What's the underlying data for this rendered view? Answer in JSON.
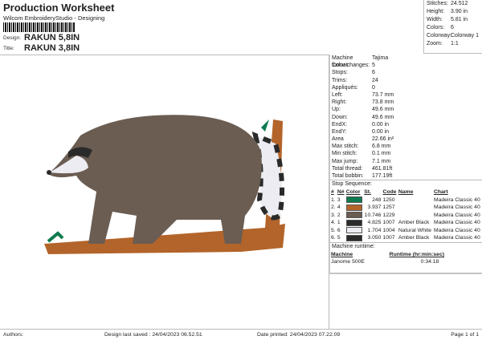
{
  "header": {
    "title": "Production Worksheet",
    "subtitle": "Wilcom EmbroideryStudio - Designing",
    "design_label": "Design:",
    "design": "RAKUN 5,8IN",
    "title_label": "Title:",
    "title_value": "RAKUN 3,8IN"
  },
  "stats": [
    {
      "k": "Stitches:",
      "v": "24.512"
    },
    {
      "k": "Height:",
      "v": "3.90 in"
    },
    {
      "k": "Width:",
      "v": "5.81 in"
    },
    {
      "k": "Colors:",
      "v": "6"
    },
    {
      "k": "Colorway:",
      "v": "Colorway 1"
    },
    {
      "k": "Zoom:",
      "v": "1:1"
    }
  ],
  "machine": [
    {
      "k": "Machine format:",
      "v": "Tajima"
    },
    {
      "k": "Color changes:",
      "v": "5"
    },
    {
      "k": "Stops:",
      "v": "6"
    },
    {
      "k": "Trims:",
      "v": "24"
    },
    {
      "k": "Appliqués:",
      "v": "0"
    },
    {
      "k": "Left:",
      "v": "73.7 mm"
    },
    {
      "k": "Right:",
      "v": "73.8 mm"
    },
    {
      "k": "Up:",
      "v": "49.6 mm"
    },
    {
      "k": "Down:",
      "v": "49.6 mm"
    },
    {
      "k": "EndX:",
      "v": "0.00 in"
    },
    {
      "k": "EndY:",
      "v": "0.00 in"
    },
    {
      "k": "Area",
      "v": "22.66 in²"
    },
    {
      "k": "Max stitch:",
      "v": "6.8 mm"
    },
    {
      "k": "Min stitch:",
      "v": "0.1 mm"
    },
    {
      "k": "Max jump:",
      "v": "7.1 mm"
    },
    {
      "k": "Total thread:",
      "v": "461.81ft"
    },
    {
      "k": "Total bobbin:",
      "v": "177.19ft"
    }
  ],
  "stop_sequence": {
    "label": "Stop Sequence:",
    "headers": [
      "#",
      "N#",
      "Color",
      "St.",
      "Code",
      "Name",
      "Chart"
    ],
    "rows": [
      {
        "n": "1.",
        "nn": "3",
        "color": "#0e7a4e",
        "st": "248",
        "code": "1250",
        "name": "",
        "chart": "Madeira Classic 40"
      },
      {
        "n": "2.",
        "nn": "4",
        "color": "#b3642a",
        "st": "3.937",
        "code": "1257",
        "name": "",
        "chart": "Madeira Classic 40"
      },
      {
        "n": "3.",
        "nn": "2",
        "color": "#6b5d52",
        "st": "10.746",
        "code": "1229",
        "name": "",
        "chart": "Madeira Classic 40"
      },
      {
        "n": "4.",
        "nn": "1",
        "color": "#2a2a2a",
        "st": "4.825",
        "code": "1007",
        "name": "Amber Black",
        "chart": "Madeira Classic 40"
      },
      {
        "n": "5.",
        "nn": "6",
        "color": "#ececf2",
        "st": "1.704",
        "code": "1004",
        "name": "Natural White",
        "chart": "Madeira Classic 40"
      },
      {
        "n": "6.",
        "nn": "5",
        "color": "#2a2a2a",
        "st": "3.050",
        "code": "1007",
        "name": "Amber Black",
        "chart": "Madeira Classic 40"
      }
    ]
  },
  "runtime": {
    "label": "Machine runtime:",
    "headers": [
      "Machine",
      "Runtime (hr:min:sec)"
    ],
    "machine": "Janome 500E",
    "time": "0:34:18"
  },
  "footer": {
    "authors": "Authors:",
    "saved": "Design last saved : 24/04/2023 06.52.51",
    "printed": "Date printed: 24/04/2023 07.22.09",
    "page": "Page 1 of 1"
  }
}
